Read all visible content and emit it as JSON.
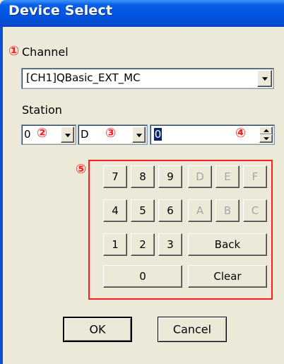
{
  "window": {
    "title": "Device Select"
  },
  "markers": [
    "①",
    "②",
    "③",
    "④",
    "⑤"
  ],
  "channel": {
    "label": "Channel",
    "value": "[CH1]QBasic_EXT_MC"
  },
  "station": {
    "label": "Station",
    "combo1_value": "0",
    "combo2_value": "D",
    "number_value": "0"
  },
  "keypad": {
    "digits": [
      "7",
      "8",
      "9",
      "4",
      "5",
      "6",
      "1",
      "2",
      "3",
      "0"
    ],
    "hex": [
      "D",
      "E",
      "F",
      "A",
      "B",
      "C"
    ],
    "back_label": "Back",
    "clear_label": "Clear"
  },
  "buttons": {
    "ok_label": "OK",
    "cancel_label": "Cancel"
  },
  "colors": {
    "title_bar": "#0054e3",
    "dialog_bg": "#ece9d8",
    "annotation_red": "#ff1e1e"
  }
}
